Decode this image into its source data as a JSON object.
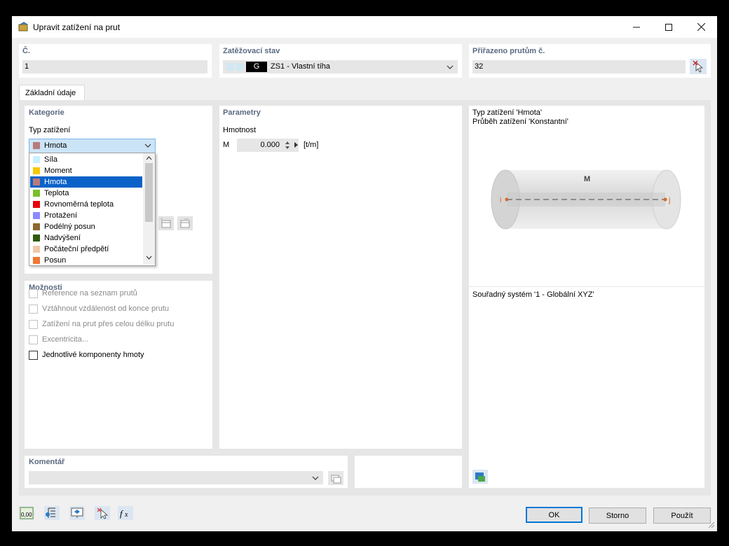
{
  "window": {
    "title": "Upravit zatížení na prut"
  },
  "header": {
    "no_label": "Č.",
    "no_value": "1",
    "load_case_label": "Zatěžovací stav",
    "load_case_badge": "G",
    "load_case_value": "ZS1 - Vlastní tíha",
    "assigned_label": "Přiřazeno prutům č.",
    "assigned_value": "32"
  },
  "tabs": [
    {
      "label": "Základní údaje"
    }
  ],
  "category": {
    "title": "Kategorie",
    "type_label": "Typ zatížení",
    "selected": {
      "label": "Hmota",
      "color": "#b97a7a"
    },
    "options": [
      {
        "label": "Síla",
        "color": "#c8f0ff"
      },
      {
        "label": "Moment",
        "color": "#f5c800"
      },
      {
        "label": "Hmota",
        "color": "#b97a7a"
      },
      {
        "label": "Teplota",
        "color": "#7ac02a"
      },
      {
        "label": "Rovnoměrná teplota",
        "color": "#e8000b"
      },
      {
        "label": "Protažení",
        "color": "#8a8aff"
      },
      {
        "label": "Podélný posun",
        "color": "#8c6a2e"
      },
      {
        "label": "Nadvýšení",
        "color": "#2e5a0a"
      },
      {
        "label": "Počáteční předpětí",
        "color": "#f0c8a8"
      },
      {
        "label": "Posun",
        "color": "#f07832"
      }
    ]
  },
  "parameters": {
    "title": "Parametry",
    "mass_label": "Hmotnost",
    "symbol": "M",
    "value": "0.000",
    "unit": "[t/m]"
  },
  "preview": {
    "line1": "Typ zatížení 'Hmota'",
    "line2": "Průběh zatížení 'Konstantní'",
    "load_symbol": "M",
    "node_i": "i",
    "node_j": "j",
    "coord_system": "Souřadný systém '1 - Globální XYZ'"
  },
  "options": {
    "title": "Možnosti",
    "items": [
      {
        "label": "Reference na seznam prutů",
        "enabled": false,
        "checked": false
      },
      {
        "label": "Vztáhnout vzdálenost od konce prutu",
        "enabled": false,
        "checked": false
      },
      {
        "label": "Zatížení na prut přes celou délku prutu",
        "enabled": false,
        "checked": false
      },
      {
        "label": "Excentricita...",
        "enabled": false,
        "checked": false
      },
      {
        "label": "Jednotlivé komponenty hmoty",
        "enabled": true,
        "checked": false
      }
    ]
  },
  "comment": {
    "title": "Komentář",
    "value": ""
  },
  "footer": {
    "ok_label": "OK",
    "cancel_label": "Storno",
    "apply_label": "Použít",
    "units_icon_text": "0,00"
  }
}
